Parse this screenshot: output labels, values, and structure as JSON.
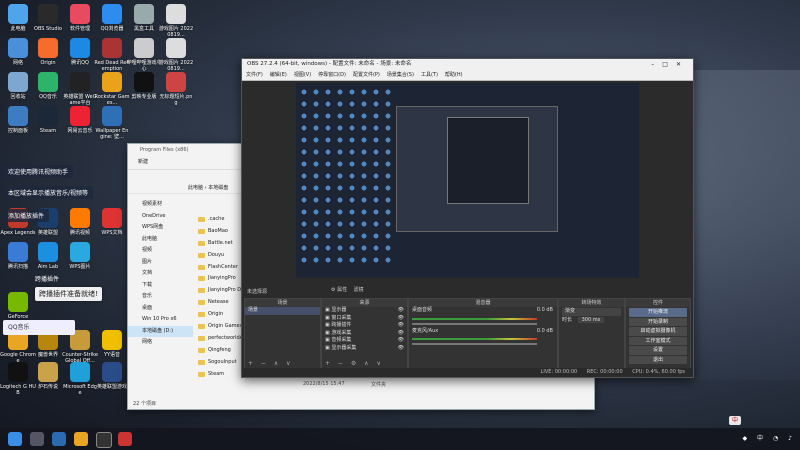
{
  "desktop": {
    "icons": [
      {
        "label": "此电脑",
        "color": "#4ea5ea"
      },
      {
        "label": "OBS Studio",
        "color": "#2a2a2a"
      },
      {
        "label": "软件管理",
        "color": "#e84a5f"
      },
      {
        "label": "QQ浏览器",
        "color": "#2d8cf0"
      },
      {
        "label": "黑盒工具",
        "color": "#9aa"
      },
      {
        "label": "游戏图片 20220819...",
        "color": "#ddd"
      },
      {
        "label": "网络",
        "color": "#4a90d9"
      },
      {
        "label": "Origin",
        "color": "#f56c2d"
      },
      {
        "label": "腾讯QQ",
        "color": "#1e88e5"
      },
      {
        "label": "Red Dead Redemption",
        "color": "#a33"
      },
      {
        "label": "哔哩哔哩游戏中心",
        "color": "#ccc"
      },
      {
        "label": "游戏图片 20220819...",
        "color": "#ddd"
      },
      {
        "label": "回收站",
        "color": "#7ea7cf"
      },
      {
        "label": "QQ音乐",
        "color": "#2db36a"
      },
      {
        "label": "英雄联盟 WeGame平台",
        "color": "#222"
      },
      {
        "label": "Rockstar Games...",
        "color": "#e9a21a"
      },
      {
        "label": "剪映专业版",
        "color": "#111"
      },
      {
        "label": "无标题短片.png",
        "color": "#c44"
      },
      {
        "label": "控制面板",
        "color": "#3e7cc2"
      },
      {
        "label": "Steam",
        "color": "#1b2838"
      },
      {
        "label": "网易云音乐",
        "color": "#e23"
      },
      {
        "label": "Wallpaper Engine: 壁...",
        "color": "#2f6fb8"
      },
      {
        "label": "Apex Legends",
        "color": "#c0392b"
      },
      {
        "label": "英雄联盟",
        "color": "#1a3f6e"
      },
      {
        "label": "腾讯视频",
        "color": "#ff7a00"
      },
      {
        "label": "WPS文档",
        "color": "#d33"
      },
      {
        "label": "腾讯扫描",
        "color": "#3a7bd5"
      },
      {
        "label": "Aim Lab",
        "color": "#1d8fe0"
      },
      {
        "label": "WPS图片",
        "color": "#2aa9e0"
      },
      {
        "label": "GeForce",
        "color": "#76b900"
      },
      {
        "label": "Google Chrome",
        "color": "#e8a623"
      },
      {
        "label": "魔兽世界",
        "color": "#b8860b"
      },
      {
        "label": "Counter-Strike Global Off...",
        "color": "#c79b3a"
      },
      {
        "label": "YY语音",
        "color": "#f0c000"
      },
      {
        "label": "Logitech G HUB",
        "color": "#111"
      },
      {
        "label": "炉石传说",
        "color": "#caa24a"
      },
      {
        "label": "Microsoft Edge",
        "color": "#1fa0d8"
      },
      {
        "label": "英雄联盟游戏",
        "color": "#2a4d8a"
      }
    ],
    "notifications": [
      "欢迎使用腾讯视频助手",
      "本区域会显示播放音乐/视频等",
      "添加播放插件"
    ],
    "plugin_label": "跨播插件",
    "speech_bubble": "跨播插件准备就绪!",
    "qq_input": "QQ音乐"
  },
  "explorer": {
    "title": "Program Files (x86)",
    "new_button": "新建",
    "address": [
      "此电脑",
      "本地磁盘"
    ],
    "sidebar": [
      "视频素材",
      "OneDrive",
      "WPS网盘",
      "此电脑",
      "视频",
      "图片",
      "文档",
      "下载",
      "音乐",
      "桌面",
      "Win 10 Pro x6",
      "本地磁盘 (D:)",
      "网络"
    ],
    "files": [
      ".cache",
      "BaoMao",
      "Battle.net",
      "Douyu",
      "FlashCenter",
      "JianyingPro",
      "JianyingPro D",
      "Netease",
      "Origin",
      "Origin Games",
      "perfectworldA",
      "Qingfeng",
      "SogouInput",
      "Steam"
    ],
    "modified": "2022/8/15 15:47",
    "type": "文件夹",
    "status": "22 个项目"
  },
  "obs": {
    "title": "OBS 27.2.4 (64-bit, windows) - 配置文件: 未命名 - 场景: 未命名",
    "menu": [
      "文件(F)",
      "编辑(E)",
      "视图(V)",
      "停靠窗口(D)",
      "配置文件(P)",
      "场景集合(S)",
      "工具(T)",
      "帮助(H)"
    ],
    "no_source": "未选择源",
    "properties": "属性",
    "filters": "滤镜",
    "scenes_header": "场景",
    "scene_item": "场景",
    "sources_header": "来源",
    "sources": [
      "显示器",
      "窗口采集",
      "跨播插件",
      "游戏采集",
      "音频采集",
      "显示器采集"
    ],
    "mixer_header": "混音器",
    "mixer_tracks": [
      {
        "name": "桌面音频",
        "db": "0.0 dB"
      },
      {
        "name": "麦克风/Aux",
        "db": "0.0 dB"
      }
    ],
    "transitions_header": "转场特效",
    "transition_type": "渐变",
    "duration_label": "时长",
    "duration_value": "300 ms",
    "controls_header": "控件",
    "controls": [
      "开始推流",
      "开始录制",
      "启动虚拟摄像机",
      "工作室模式",
      "设置",
      "退出"
    ],
    "status": {
      "live": "LIVE: 00:00:00",
      "rec": "REC: 00:00:00",
      "cpu": "CPU: 0.4%, 60.00 fps"
    }
  },
  "taskbar": {
    "time": "2022/8/...",
    "lang": "中",
    "ime_label": "中"
  }
}
